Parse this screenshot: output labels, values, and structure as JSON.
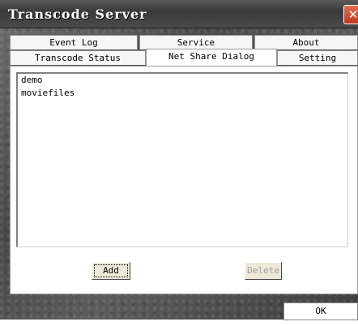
{
  "window": {
    "title": "Transcode Server"
  },
  "tabs": {
    "row_back": [
      "Event Log",
      "Service",
      "About"
    ],
    "row_front": [
      "Transcode Status",
      "Net Share Dialog",
      "Setting"
    ],
    "active": "Net Share Dialog"
  },
  "share_list": {
    "items": [
      "demo",
      "moviefiles"
    ]
  },
  "buttons": {
    "add": "Add",
    "delete": "Delete",
    "ok": "OK"
  },
  "icons": {
    "close": "close-icon"
  }
}
